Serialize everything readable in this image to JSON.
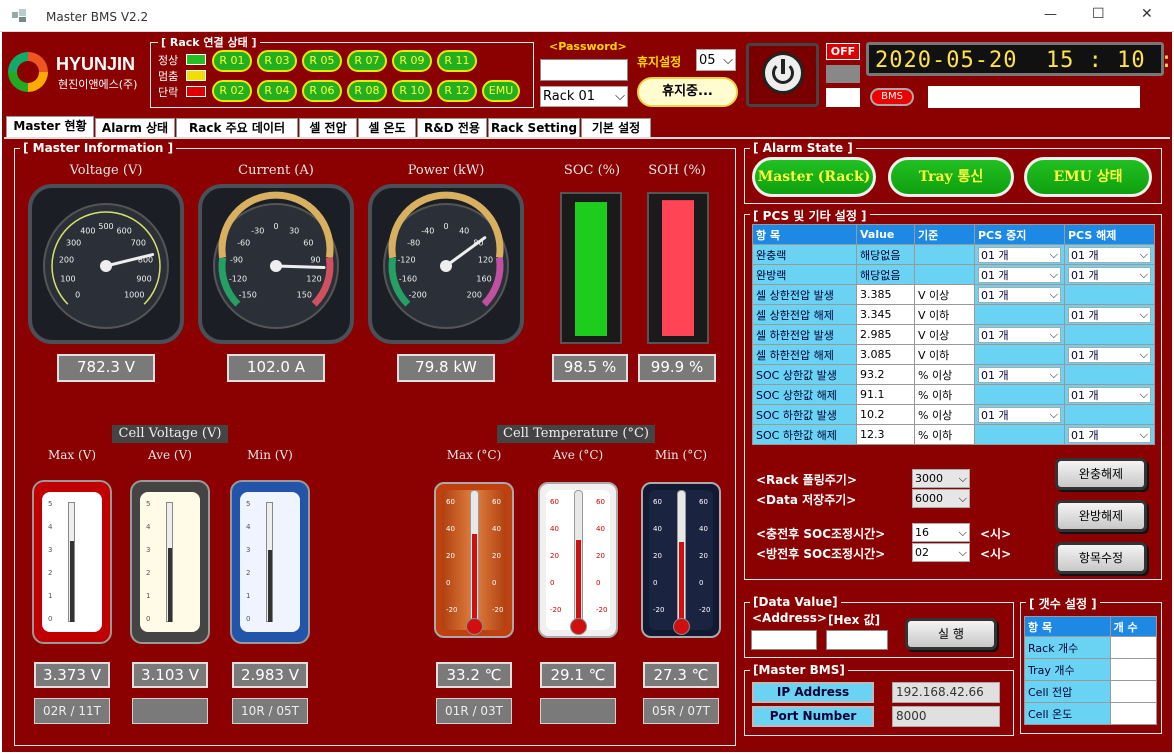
{
  "window": {
    "title": "Master BMS V2.2",
    "min": "—",
    "max": "☐",
    "close": "✕"
  },
  "brand": {
    "name": "HYUNJIN",
    "sub": "현진이앤에스(주)"
  },
  "rack_status": {
    "title": "[ Rack 연결 상태 ]",
    "legend": [
      {
        "label": "정상",
        "color": "#22c022"
      },
      {
        "label": "멈춤",
        "color": "#f0e000"
      },
      {
        "label": "단락",
        "color": "#e00000"
      }
    ],
    "row1": [
      "R 01",
      "R 03",
      "R 05",
      "R 07",
      "R 09",
      "R 11"
    ],
    "row2": [
      "R 02",
      "R 04",
      "R 06",
      "R 08",
      "R 10",
      "R 12",
      "EMU"
    ]
  },
  "password": {
    "label": "<Password>",
    "value": ""
  },
  "rack_select": {
    "value": "Rack 01"
  },
  "rest": {
    "label": "휴지설정",
    "value": "05",
    "button": "휴지중..."
  },
  "off": {
    "label": "OFF"
  },
  "datetime": "2020-05-20  15 : 10 : 32",
  "bms_badge": "BMS",
  "tabs": [
    "Master 현황",
    "Alarm 상태",
    "Rack 주요 데이터",
    "셀 전압",
    "셀 온도",
    "R&D 전용",
    "Rack Setting",
    "기본 설정"
  ],
  "master_info": {
    "title": "[ Master Information ]",
    "voltage": {
      "label": "Voltage (V)",
      "value": "782.3 V",
      "ticks": [
        "0",
        "100",
        "200",
        "300",
        "400",
        "500",
        "600",
        "700",
        "800",
        "900",
        "1000"
      ],
      "reading": 782.3
    },
    "current": {
      "label": "Current (A)",
      "value": "102.0 A",
      "ticks": [
        "-150",
        "-120",
        "-90",
        "-60",
        "-30",
        "0",
        "30",
        "60",
        "90",
        "120",
        "150"
      ],
      "reading": 102.0
    },
    "power": {
      "label": "Power (kW)",
      "value": "79.8 kW",
      "ticks": [
        "-200",
        "-160",
        "-120",
        "-80",
        "-40",
        "0",
        "40",
        "80",
        "120",
        "160",
        "200"
      ],
      "reading": 79.8
    },
    "soc": {
      "label": "SOC (%)",
      "value": "98.5 %",
      "level": 0.985,
      "color": "#1ecc1e"
    },
    "soh": {
      "label": "SOH (%)",
      "value": "99.9 %",
      "level": 0.999,
      "color": "#ff4455"
    }
  },
  "cell_voltage": {
    "title": "Cell Voltage (V)",
    "cols": [
      {
        "label": "Max (V)",
        "value": "3.373 V",
        "sub": "02R / 11T"
      },
      {
        "label": "Ave (V)",
        "value": "3.103 V",
        "sub": ""
      },
      {
        "label": "Min (V)",
        "value": "2.983 V",
        "sub": "10R / 05T"
      }
    ],
    "ticks": [
      "0",
      "1",
      "2",
      "3",
      "4",
      "5"
    ]
  },
  "cell_temp": {
    "title": "Cell Temperature (°C)",
    "cols": [
      {
        "label": "Max (°C)",
        "value": "33.2 ℃",
        "sub": "01R / 03T"
      },
      {
        "label": "Ave (°C)",
        "value": "29.1 ℃",
        "sub": ""
      },
      {
        "label": "Min (°C)",
        "value": "27.3 ℃",
        "sub": "05R / 07T"
      }
    ],
    "ticks": [
      "60",
      "40",
      "20",
      "0",
      "-20"
    ]
  },
  "alarm_state": {
    "title": "[ Alarm State ]",
    "buttons": [
      "Master (Rack)",
      "Tray 통신",
      "EMU 상태"
    ]
  },
  "pcs": {
    "title": "[ PCS 및 기타 설정 ]",
    "headers": [
      "항 목",
      "Value",
      "기준",
      "PCS 중지",
      "PCS 해제"
    ],
    "rows": [
      {
        "item": "완충랙",
        "value": "해당없음",
        "std": "",
        "stop": "01 개",
        "release": "01 개"
      },
      {
        "item": "완방랙",
        "value": "해당없음",
        "std": "",
        "stop": "01 개",
        "release": "01 개"
      },
      {
        "item": "셀 상한전압 발생",
        "value": "3.385",
        "std": "V 이상",
        "stop": "01 개",
        "release": ""
      },
      {
        "item": "셀 상한전압 해제",
        "value": "3.345",
        "std": "V 이하",
        "stop": "",
        "release": "01 개"
      },
      {
        "item": "셀 하한전압 발생",
        "value": "2.985",
        "std": "V 이상",
        "stop": "01 개",
        "release": ""
      },
      {
        "item": "셀 하한전압 해제",
        "value": "3.085",
        "std": "V 이하",
        "stop": "",
        "release": "01 개"
      },
      {
        "item": "SOC 상한값 발생",
        "value": "93.2",
        "std": "% 이상",
        "stop": "01 개",
        "release": ""
      },
      {
        "item": "SOC 상한값 해제",
        "value": "91.1",
        "std": "% 이하",
        "stop": "",
        "release": "01 개"
      },
      {
        "item": "SOC 하한값 발생",
        "value": "10.2",
        "std": "% 이상",
        "stop": "01 개",
        "release": ""
      },
      {
        "item": "SOC 하한값 해제",
        "value": "12.3",
        "std": "% 이하",
        "stop": "",
        "release": "01 개"
      }
    ]
  },
  "settings": {
    "polling_label": "<Rack 폴링주기>",
    "polling": "3000",
    "save_label": "<Data 저장주기>",
    "save": "6000",
    "charge_label": "<충전후 SOC조정시간>",
    "charge": "16",
    "discharge_label": "<방전후 SOC조정시간>",
    "discharge": "02",
    "unit": "<시>",
    "btn_full_charge": "완충해제",
    "btn_full_discharge": "완방해제",
    "btn_modify": "항목수정"
  },
  "data_value": {
    "title": "[Data Value]",
    "address_label": "<Address>",
    "hex_label": "[Hex 값]",
    "execute": "실 행",
    "address": "",
    "hex": ""
  },
  "master_bms": {
    "title": "[Master BMS]",
    "ip_label": "IP Address",
    "ip": "192.168.42.66",
    "port_label": "Port Number",
    "port": "8000"
  },
  "count": {
    "title": "[ 갯수 설정 ]",
    "headers": [
      "항 목",
      "개 수"
    ],
    "rows": [
      "Rack 개수",
      "Tray 개수",
      "Cell 전압",
      "Cell 온도"
    ]
  }
}
